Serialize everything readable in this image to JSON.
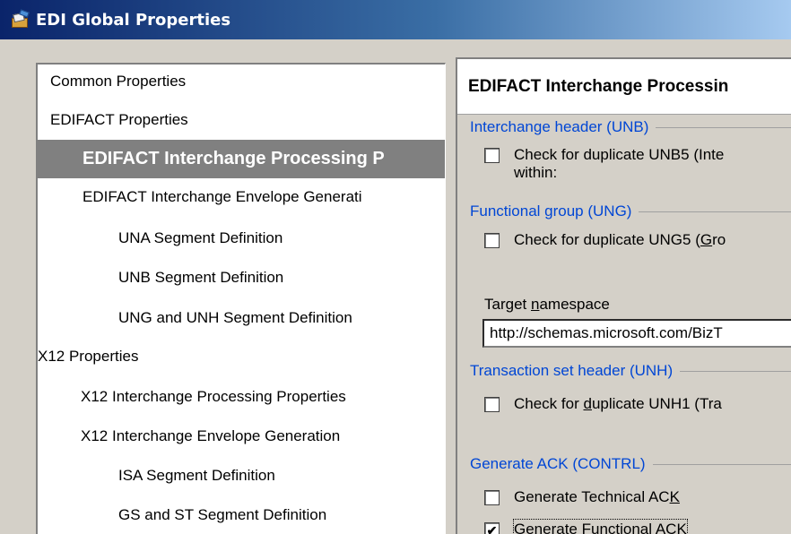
{
  "window": {
    "title": "EDI Global Properties",
    "icon": "properties-icon"
  },
  "tree": {
    "items": [
      {
        "label": "Common Properties",
        "level": 0
      },
      {
        "label": "EDIFACT Properties",
        "level": 0
      },
      {
        "label": "EDIFACT Interchange Processing P",
        "level": 1,
        "selected": true
      },
      {
        "label": "EDIFACT Interchange Envelope Generati",
        "level": 1
      },
      {
        "label": "UNA Segment Definition",
        "level": 2
      },
      {
        "label": "UNB Segment Definition",
        "level": 2
      },
      {
        "label": "UNG and UNH Segment Definition",
        "level": 2
      },
      {
        "label": "X12 Properties",
        "level": 0
      },
      {
        "label": "X12 Interchange Processing Properties",
        "level": 1
      },
      {
        "label": "X12 Interchange Envelope Generation",
        "level": 1
      },
      {
        "label": "ISA Segment Definition",
        "level": 2
      },
      {
        "label": "GS and ST Segment Definition",
        "level": 2
      }
    ]
  },
  "panel": {
    "header": "EDIFACT Interchange Processin",
    "interchange_header": {
      "label": "Interchange header (UNB)",
      "check_dup_unb5": {
        "text": "Check for duplicate UNB5 (Inte",
        "text2": "within:",
        "checked": false
      }
    },
    "functional_group": {
      "label": "Functional group (UNG)",
      "check_dup_ung5": {
        "pre": "Check for duplicate UNG5 (",
        "mn": "G",
        "post": "ro",
        "checked": false
      }
    },
    "target_namespace": {
      "pre": "Target ",
      "mn": "n",
      "post": "amespace",
      "value": "http://schemas.microsoft.com/BizT"
    },
    "transaction_set_header": {
      "label": "Transaction set header (UNH)",
      "check_dup_unh1": {
        "pre": "Check for ",
        "mn": "d",
        "post": "uplicate UNH1 (Tra",
        "checked": false
      }
    },
    "generate_ack": {
      "label": "Generate ACK (CONTRL)",
      "technical": {
        "pre": "Generate Technical AC",
        "mn": "K",
        "post": "",
        "checked": false
      },
      "functional": {
        "pre": "Generate Functional AC",
        "mn": "K",
        "post": "",
        "checked": true
      }
    }
  }
}
